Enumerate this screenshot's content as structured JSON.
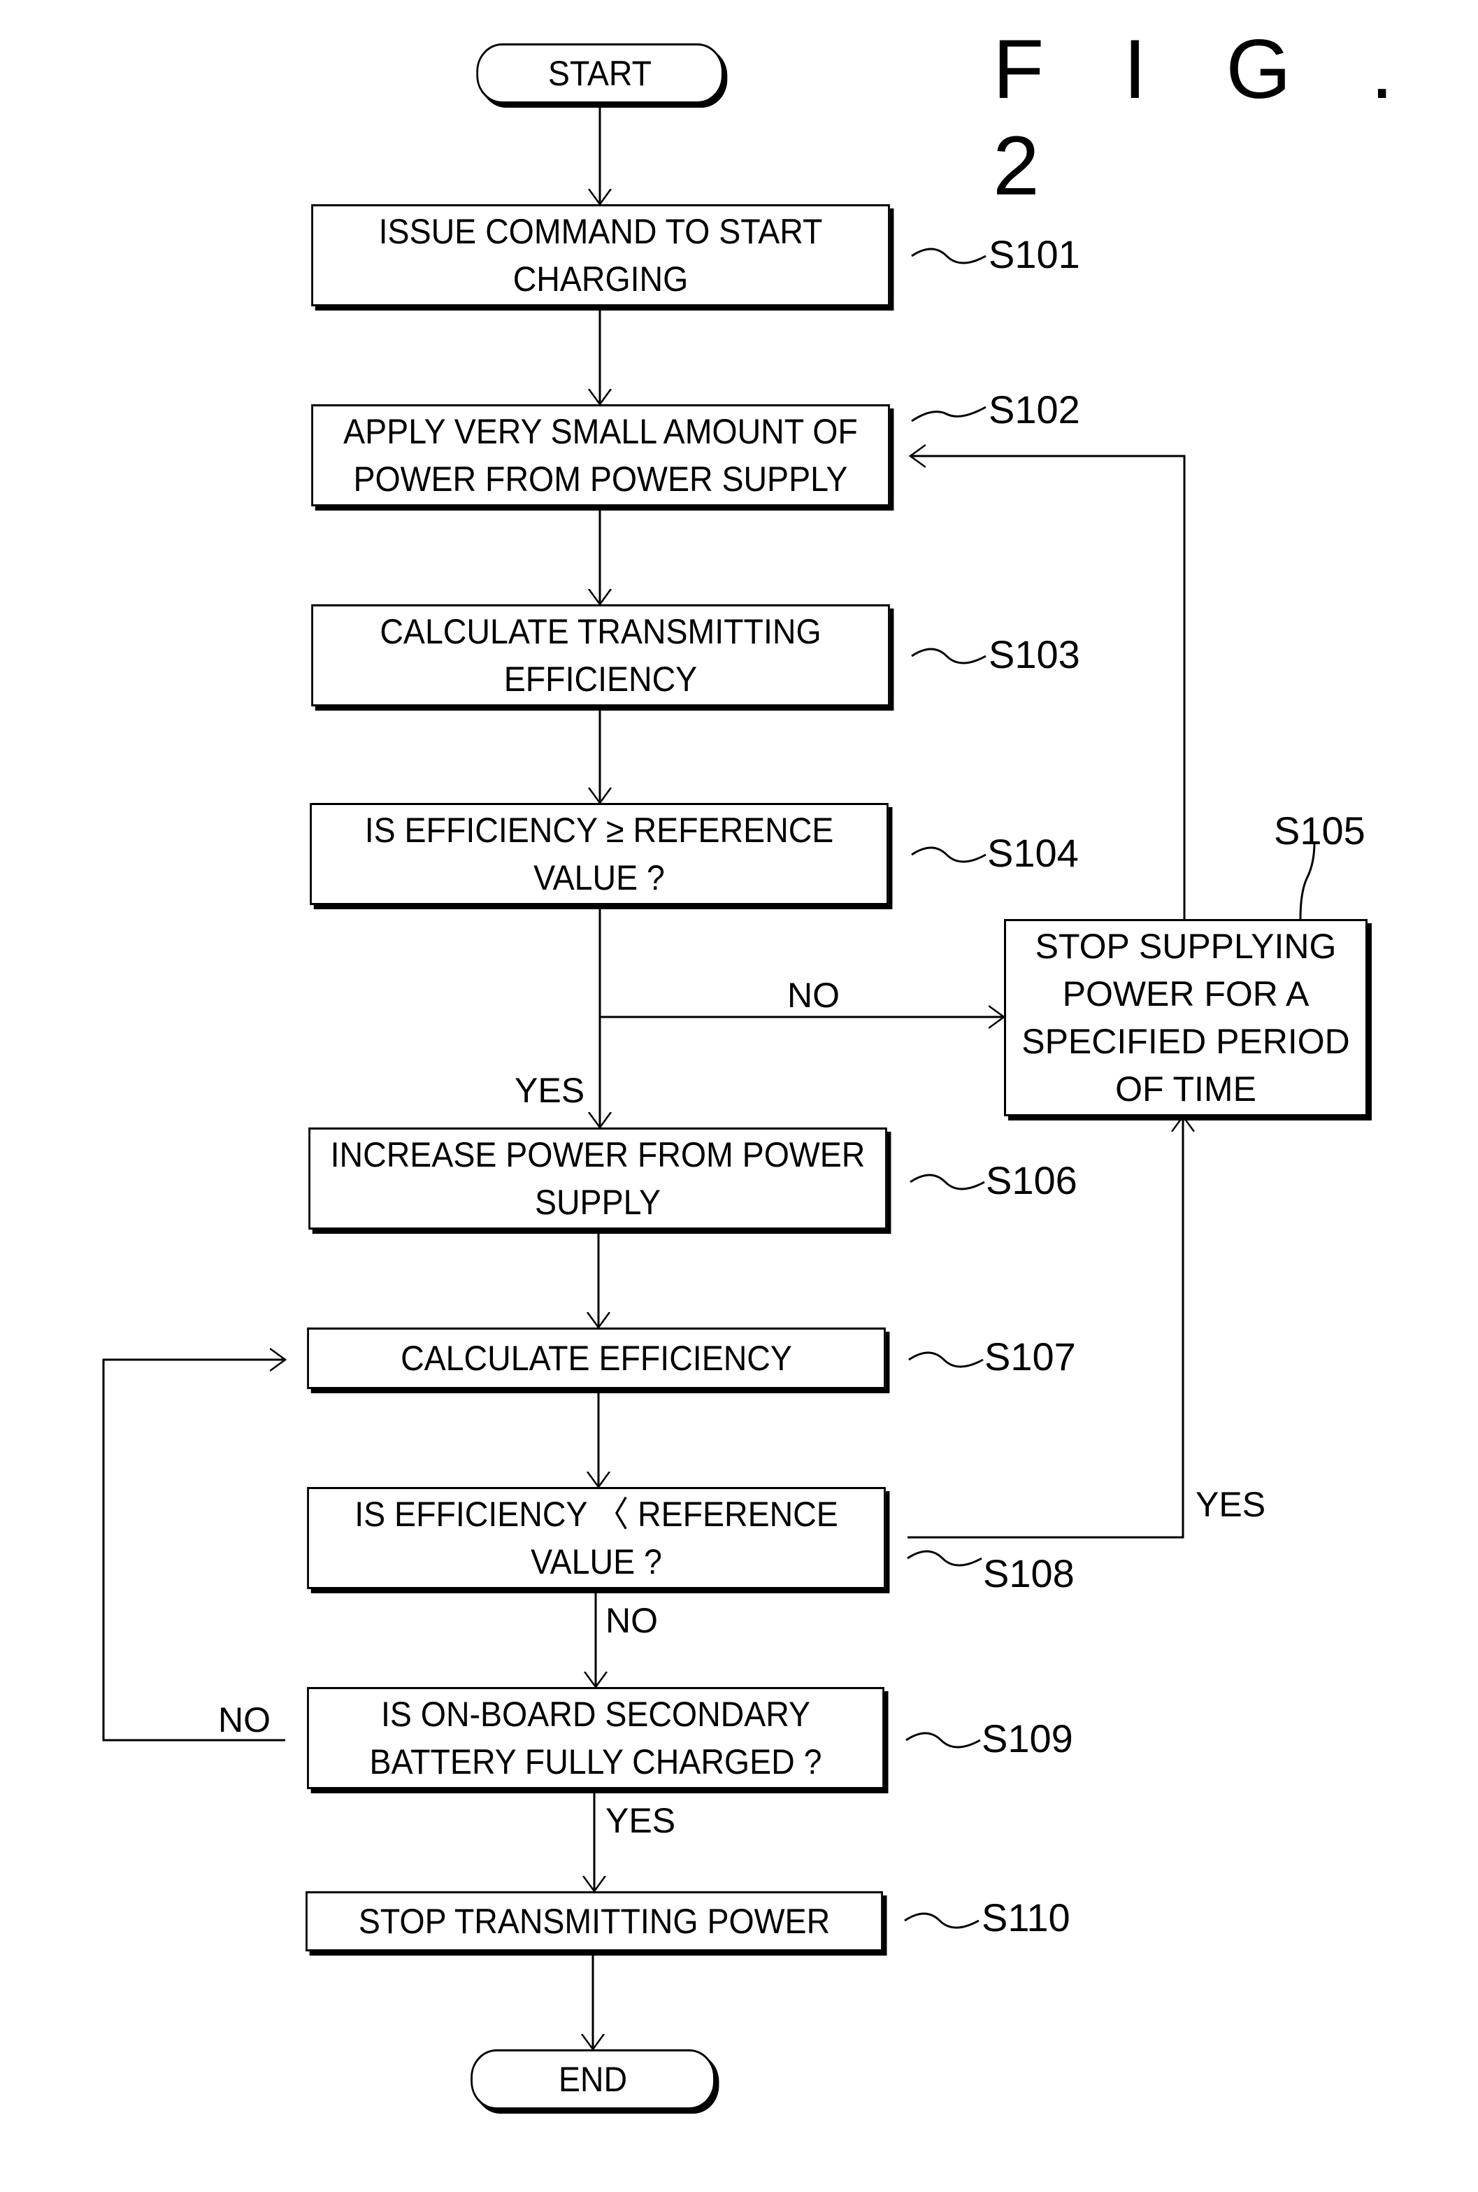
{
  "figure": {
    "title": "F I G . 2"
  },
  "terminals": {
    "start": "START",
    "end": "END"
  },
  "steps": [
    {
      "id": "S101",
      "lines": [
        "ISSUE COMMAND TO START",
        "CHARGING"
      ]
    },
    {
      "id": "S102",
      "lines": [
        "APPLY VERY SMALL AMOUNT OF",
        "POWER FROM POWER SUPPLY"
      ]
    },
    {
      "id": "S103",
      "lines": [
        "CALCULATE TRANSMITTING",
        "EFFICIENCY"
      ]
    },
    {
      "id": "S104",
      "lines": [
        "IS EFFICIENCY ≥ REFERENCE",
        "VALUE ?"
      ]
    },
    {
      "id": "S105",
      "lines": [
        "STOP SUPPLYING",
        "POWER FOR A",
        "SPECIFIED PERIOD",
        "OF TIME"
      ]
    },
    {
      "id": "S106",
      "lines": [
        "INCREASE POWER FROM POWER",
        "SUPPLY"
      ]
    },
    {
      "id": "S107",
      "lines": [
        "CALCULATE EFFICIENCY"
      ]
    },
    {
      "id": "S108",
      "lines": [
        "IS EFFICIENCY 〈 REFERENCE",
        "VALUE ?"
      ]
    },
    {
      "id": "S109",
      "lines": [
        "IS ON-BOARD SECONDARY",
        "BATTERY FULLY CHARGED ?"
      ]
    },
    {
      "id": "S110",
      "lines": [
        "STOP TRANSMITTING POWER"
      ]
    }
  ],
  "branches": {
    "s104_no": "NO",
    "s104_yes": "YES",
    "s108_yes": "YES",
    "s108_no": "NO",
    "s109_no": "NO",
    "s109_yes": "YES"
  }
}
